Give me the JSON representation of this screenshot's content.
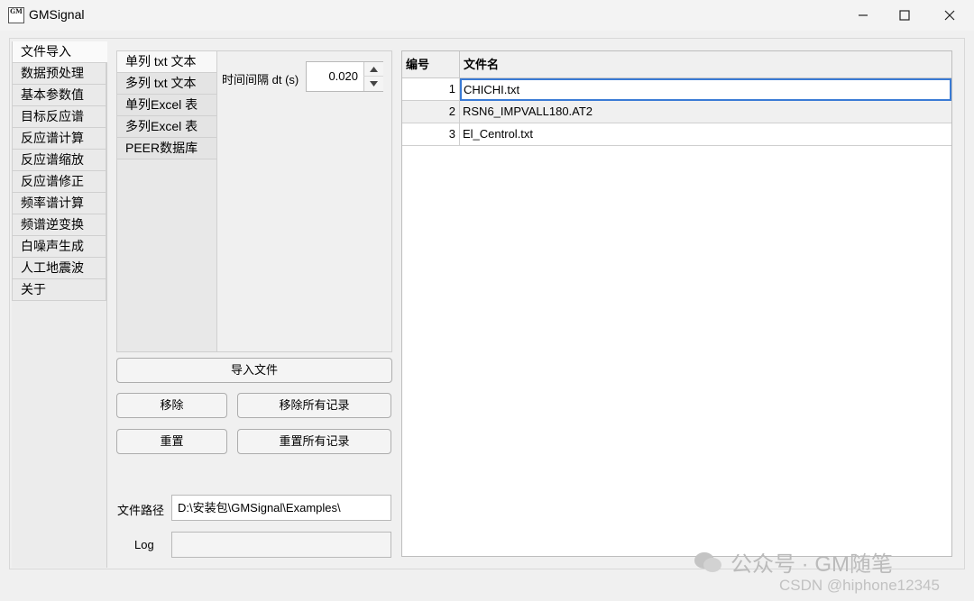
{
  "window": {
    "icon_text": "GM",
    "title": "GMSignal"
  },
  "left_tabs": [
    {
      "label": "文件导入",
      "active": true
    },
    {
      "label": "数据预处理"
    },
    {
      "label": "基本参数值"
    },
    {
      "label": "目标反应谱"
    },
    {
      "label": "反应谱计算"
    },
    {
      "label": "反应谱缩放"
    },
    {
      "label": "反应谱修正"
    },
    {
      "label": "频率谱计算"
    },
    {
      "label": "频谱逆变换"
    },
    {
      "label": "白噪声生成"
    },
    {
      "label": "人工地震波"
    },
    {
      "label": "关于"
    }
  ],
  "sub_tabs": [
    {
      "label": "单列 txt 文本",
      "active": true
    },
    {
      "label": "多列 txt 文本"
    },
    {
      "label": "单列Excel 表"
    },
    {
      "label": "多列Excel 表"
    },
    {
      "label": "PEER数据库"
    }
  ],
  "dt": {
    "label": "时间间隔 dt (s)",
    "value": "0.020"
  },
  "buttons": {
    "import": "导入文件",
    "remove": "移除",
    "remove_all": "移除所有记录",
    "reset": "重置",
    "reset_all": "重置所有记录"
  },
  "path": {
    "label": "文件路径",
    "value": "D:\\安装包\\GMSignal\\Examples\\"
  },
  "log": {
    "label": "Log",
    "value": ""
  },
  "table": {
    "headers": [
      "编号",
      "文件名"
    ],
    "rows": [
      {
        "num": "1",
        "name": "CHICHI.txt"
      },
      {
        "num": "2",
        "name": "RSN6_IMPVALL180.AT2"
      },
      {
        "num": "3",
        "name": "El_Centrol.txt"
      }
    ]
  },
  "watermark": {
    "text": "公众号 · GM随笔",
    "csdn": "CSDN @hiphone12345"
  }
}
